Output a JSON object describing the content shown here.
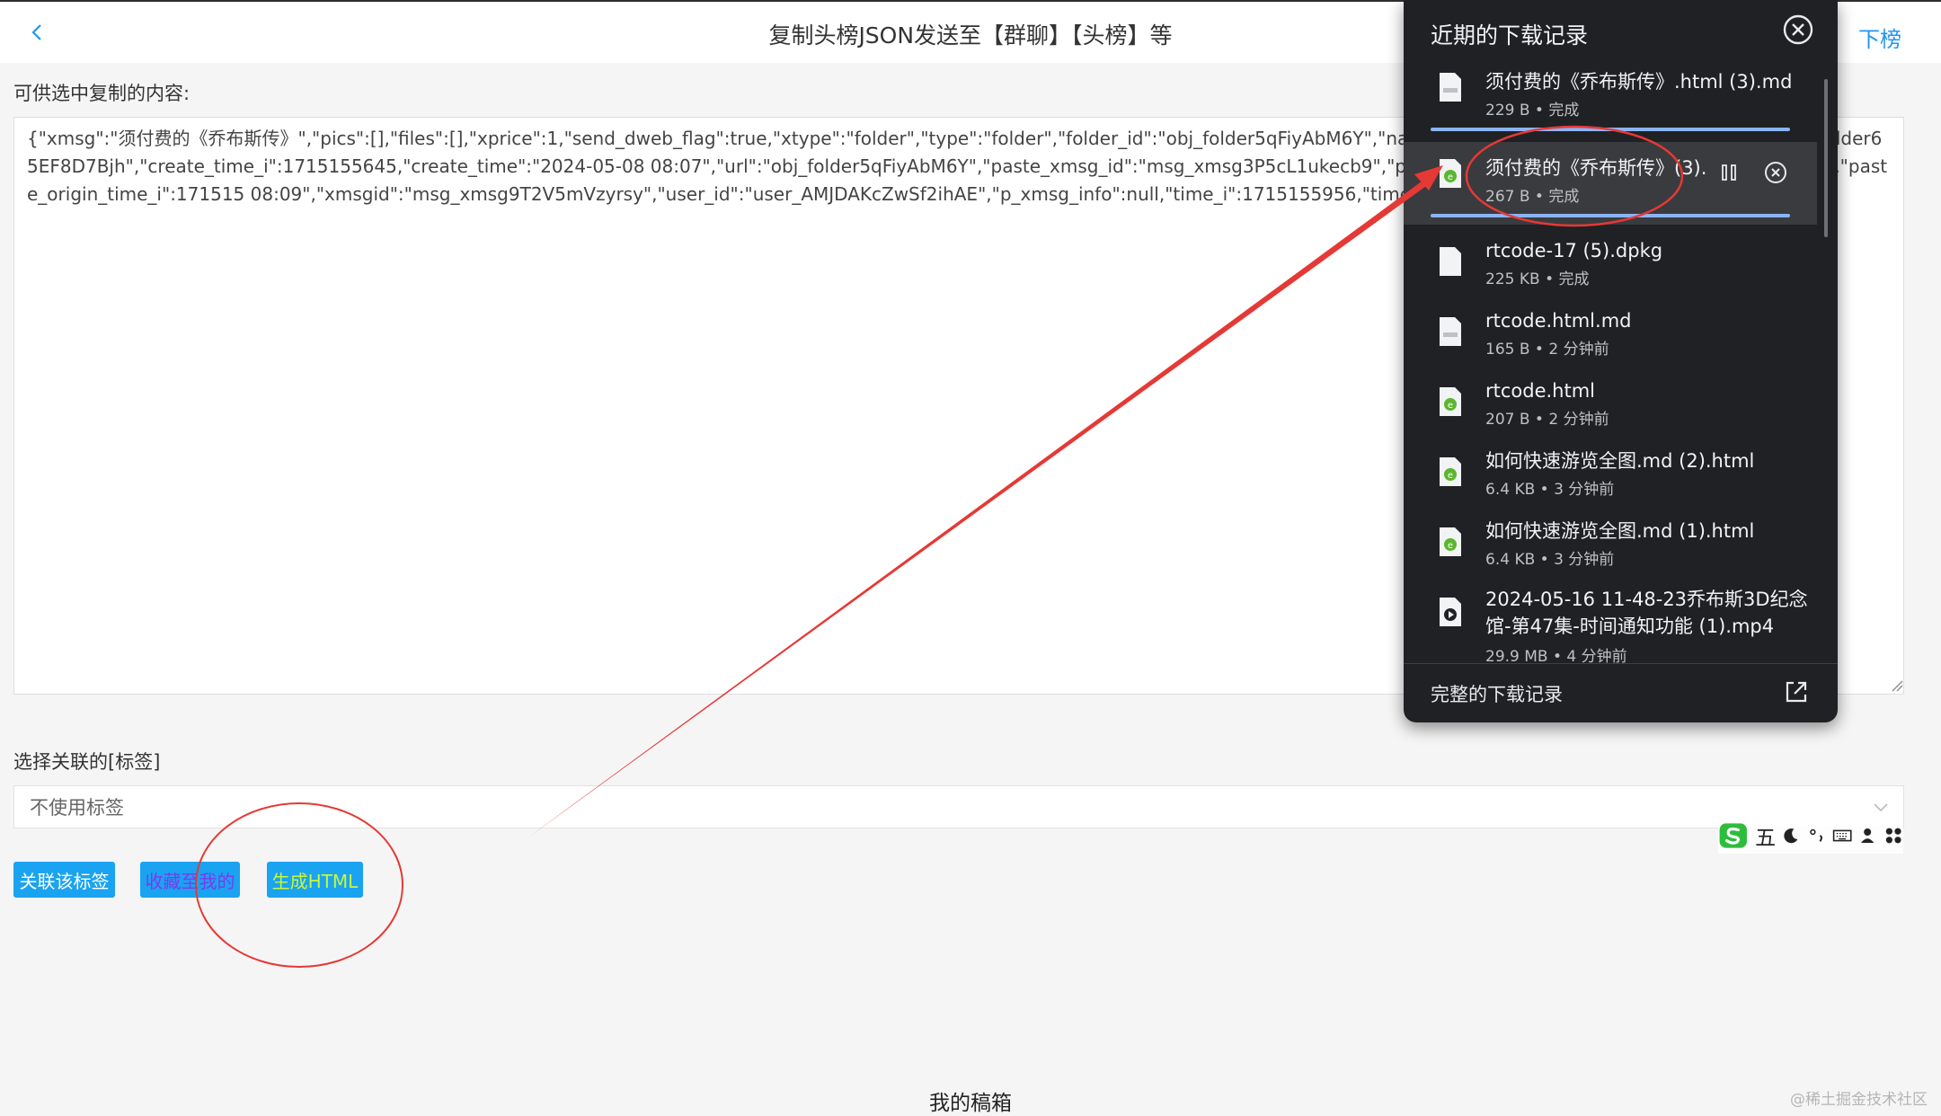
{
  "header": {
    "title": "复制头榜JSON发送至【群聊】【头榜】等",
    "right_link": "下榜"
  },
  "content": {
    "label": "可供选中复制的内容:",
    "text": "{\"xmsg\":\"须付费的《乔布斯传》\",\"pics\":[],\"files\":[],\"xprice\":1,\"send_dweb_flag\":true,\"xtype\":\"folder\",\"type\":\"folder\",\"folder_id\":\"obj_folder5qFiyAbM6Y\",\"name\":\"须付费的《乔布斯传》\",\"p_folder_id\":\"obj_folder65EF8D7Bjh\",\"create_time_i\":1715155645,\"create_time\":\"2024-05-08 08:07\",\"url\":\"obj_folder5qFiyAbM6Y\",\"paste_xmsg_id\":\"msg_xmsg3P5cL1ukecb9\",\"paste_origin_user_id\":\"user_AMJDAKcZwSf2ihAE\",\"paste_origin_time_i\":171515 08:09\",\"xmsgid\":\"msg_xmsg9T2V5mVzyrsy\",\"user_id\":\"user_AMJDAKcZwSf2ihAE\",\"p_xmsg_info\":null,\"time_i\":1715155956,\"time_str\":\"2024-05-08 08:12\",\"token_y"
  },
  "tag": {
    "label": "选择关联的[标签]",
    "selected": "不使用标签"
  },
  "buttons": {
    "link_tag": "关联该标签",
    "favorite": "收藏至我的",
    "generate_html": "生成HTML"
  },
  "footer": {
    "text": "我的稿箱",
    "watermark": "@稀土掘金技术社区"
  },
  "downloads": {
    "title": "近期的下载记录",
    "footer_label": "完整的下载记录",
    "items": [
      {
        "name": "须付费的《乔布斯传》.html (3).md",
        "meta": "229 B • 完成",
        "icon": "file-doc-icon"
      },
      {
        "name": "须付费的《乔布斯传》(3).",
        "meta": "267 B • 完成",
        "icon": "html-file-icon"
      },
      {
        "name": "rtcode-17 (5).dpkg",
        "meta": "225 KB • 完成",
        "icon": "file-icon"
      },
      {
        "name": "rtcode.html.md",
        "meta": "165 B • 2 分钟前",
        "icon": "file-doc-icon"
      },
      {
        "name": "rtcode.html",
        "meta": "207 B • 2 分钟前",
        "icon": "html-file-icon"
      },
      {
        "name": "如何快速游览全图.md (2).html",
        "meta": "6.4 KB • 3 分钟前",
        "icon": "html-file-icon"
      },
      {
        "name": "如何快速游览全图.md (1).html",
        "meta": "6.4 KB • 3 分钟前",
        "icon": "html-file-icon"
      },
      {
        "name_line1": "2024-05-16 11-48-23乔布斯3D纪念",
        "name_line2": "馆-第47集-时间通知功能 (1).mp4",
        "meta": "29.9 MB • 4 分钟前",
        "icon": "video-file-icon"
      }
    ]
  },
  "ime": {
    "mode_char": "五"
  },
  "colors": {
    "accent": "#1aa3f0",
    "annotation_red": "#e53935",
    "panel_bg": "#202124",
    "progress": "#8ab4f8"
  }
}
